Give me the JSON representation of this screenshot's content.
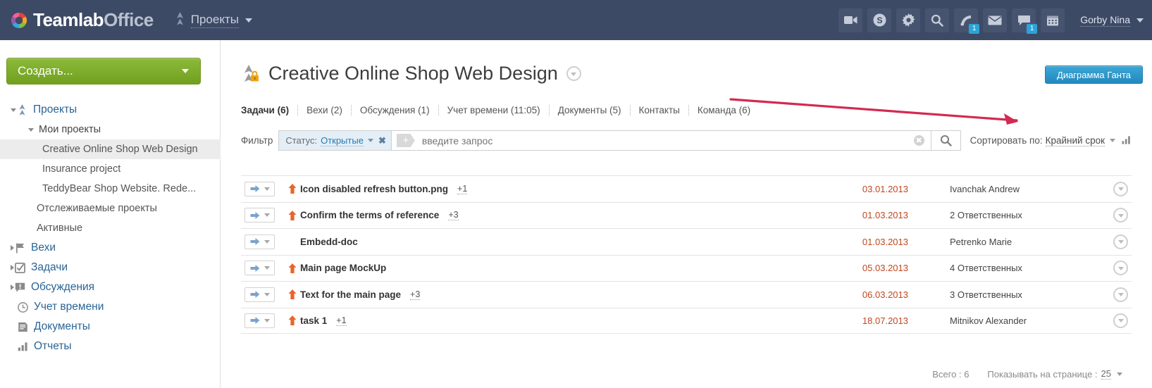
{
  "header": {
    "logo_primary": "Teamlab",
    "logo_secondary": "Office",
    "module_label": "Проекты",
    "module_icon": "projects-icon",
    "icons": [
      {
        "name": "video-icon",
        "badge": null
      },
      {
        "name": "money-icon",
        "badge": null
      },
      {
        "name": "gear-icon",
        "badge": null
      },
      {
        "name": "search-icon",
        "badge": null
      },
      {
        "name": "feed-icon",
        "badge": "1"
      },
      {
        "name": "mail-icon",
        "badge": null
      },
      {
        "name": "chat-icon",
        "badge": "1"
      },
      {
        "name": "calendar-icon",
        "badge": null
      }
    ],
    "user_name": "Gorby Nina",
    "bg_color": "#3d4a66"
  },
  "sidebar": {
    "create_button": "Создать...",
    "items": [
      {
        "label": "Проекты",
        "level": 0,
        "icon": "projects-icon",
        "expanded": true,
        "selected": false
      },
      {
        "label": "Мои проекты",
        "level": 1,
        "icon": null,
        "expanded": true,
        "selected": false
      },
      {
        "label": "Creative Online Shop Web Design",
        "level": 2,
        "icon": null,
        "selected": true
      },
      {
        "label": "Insurance project",
        "level": 2,
        "icon": null,
        "selected": false
      },
      {
        "label": "TeddyBear Shop Website. Rede...",
        "level": 2,
        "icon": null,
        "selected": false
      },
      {
        "label": "Отслеживаемые проекты",
        "level": "1b",
        "icon": null,
        "selected": false
      },
      {
        "label": "Активные",
        "level": "1b",
        "icon": null,
        "selected": false
      },
      {
        "label": "Вехи",
        "level": 0,
        "icon": "flag-icon",
        "expanded": false,
        "selected": false
      },
      {
        "label": "Задачи",
        "level": 0,
        "icon": "checkbox-icon",
        "expanded": false,
        "selected": false
      },
      {
        "label": "Обсуждения",
        "level": 0,
        "icon": "discussion-icon",
        "expanded": false,
        "selected": false
      },
      {
        "label": "Учет времени",
        "level": 0,
        "icon": "clock-icon",
        "expanded": null,
        "selected": false
      },
      {
        "label": "Документы",
        "level": 0,
        "icon": "document-icon",
        "expanded": null,
        "selected": false
      },
      {
        "label": "Отчеты",
        "level": 0,
        "icon": "report-icon",
        "expanded": null,
        "selected": false
      }
    ]
  },
  "main": {
    "page_title": "Creative Online Shop Web Design",
    "title_icon": "project-private-icon",
    "gantt_button": "Диаграмма Ганта",
    "tabs": [
      {
        "label": "Задачи (6)",
        "active": true
      },
      {
        "label": "Вехи (2)",
        "active": false
      },
      {
        "label": "Обсуждения (1)",
        "active": false
      },
      {
        "label": "Учет времени (11:05)",
        "active": false
      },
      {
        "label": "Документы (5)",
        "active": false
      },
      {
        "label": "Контакты",
        "active": false
      },
      {
        "label": "Команда (6)",
        "active": false
      }
    ],
    "filter": {
      "label": "Фильтр",
      "chip_key": "Статус:",
      "chip_value": "Открытые",
      "add_label": "+",
      "query_value": "",
      "query_placeholder": "введите запрос"
    },
    "sort": {
      "label": "Сортировать по:",
      "value": "Крайний срок"
    },
    "tasks": [
      {
        "title": "Icon disabled refresh button.png",
        "subcount": "+1",
        "priority": true,
        "date": "03.01.2013",
        "assignee": "Ivanchak Andrew"
      },
      {
        "title": "Confirm the terms of reference",
        "subcount": "+3",
        "priority": true,
        "date": "01.03.2013",
        "assignee": "2 Ответственных"
      },
      {
        "title": "Embedd-doc",
        "subcount": "",
        "priority": false,
        "date": "01.03.2013",
        "assignee": "Petrenko Marie"
      },
      {
        "title": "Main page MockUp",
        "subcount": "",
        "priority": true,
        "date": "05.03.2013",
        "assignee": "4 Ответственных"
      },
      {
        "title": "Text for the main page",
        "subcount": "+3",
        "priority": true,
        "date": "06.03.2013",
        "assignee": "3 Ответственных"
      },
      {
        "title": "task 1",
        "subcount": "+1",
        "priority": true,
        "date": "18.07.2013",
        "assignee": "Mitnikov Alexander"
      }
    ],
    "footer": {
      "total_label": "Всего : 6",
      "per_page_label": "Показывать на странице :",
      "per_page_value": "25"
    }
  },
  "annotation": {
    "arrow_color": "#d32a52"
  },
  "colors": {
    "accent_blue": "#2389bf",
    "green": "#7aab28",
    "date_orange": "#c0471f",
    "priority_orange": "#e8652a",
    "link_blue": "#2a6496"
  }
}
